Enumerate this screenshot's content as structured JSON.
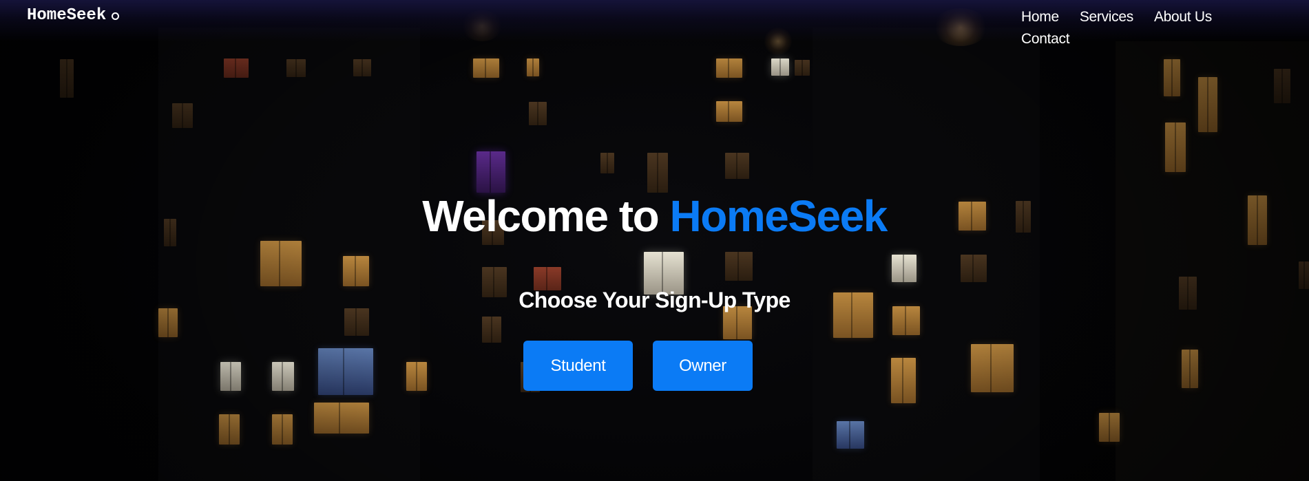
{
  "header": {
    "brand": "HomeSeek",
    "brand_icon": "ring-icon",
    "nav": [
      {
        "label": "Home"
      },
      {
        "label": "Services"
      },
      {
        "label": "About Us"
      },
      {
        "label": "Contact"
      }
    ]
  },
  "hero": {
    "title_prefix": "Welcome to",
    "title_accent": "HomeSeek",
    "subtitle": "Choose Your Sign-Up Type",
    "buttons": [
      {
        "label": "Student"
      },
      {
        "label": "Owner"
      }
    ]
  },
  "colors": {
    "accent": "#0b7bf5",
    "text": "#ffffff",
    "header_bg": "#16143c",
    "background": "#030305"
  }
}
